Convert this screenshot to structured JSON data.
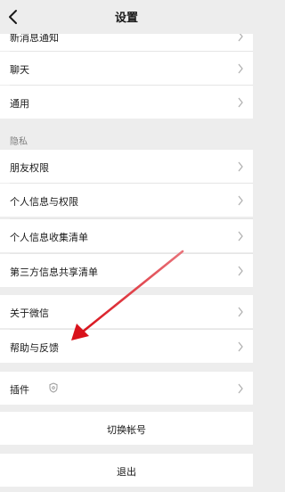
{
  "header": {
    "title": "设置"
  },
  "groups": {
    "top": {
      "items": [
        {
          "label": "新消息通知"
        },
        {
          "label": "聊天"
        },
        {
          "label": "通用"
        }
      ]
    },
    "privacy": {
      "section_label": "隐私",
      "items": [
        {
          "label": "朋友权限"
        },
        {
          "label": "个人信息与权限"
        },
        {
          "label": "个人信息收集清单"
        },
        {
          "label": "第三方信息共享清单"
        }
      ]
    },
    "about": {
      "items": [
        {
          "label": "关于微信"
        },
        {
          "label": "帮助与反馈"
        }
      ]
    },
    "plugins": {
      "label": "插件"
    },
    "actions": {
      "switch_account": "切换帐号",
      "logout": "退出"
    }
  },
  "annotation": {
    "arrow_color": "#d9121b"
  },
  "icons": {
    "back": "chevron-left-icon",
    "row_nav": "chevron-right-icon",
    "plugin_badge": "shield-icon"
  }
}
